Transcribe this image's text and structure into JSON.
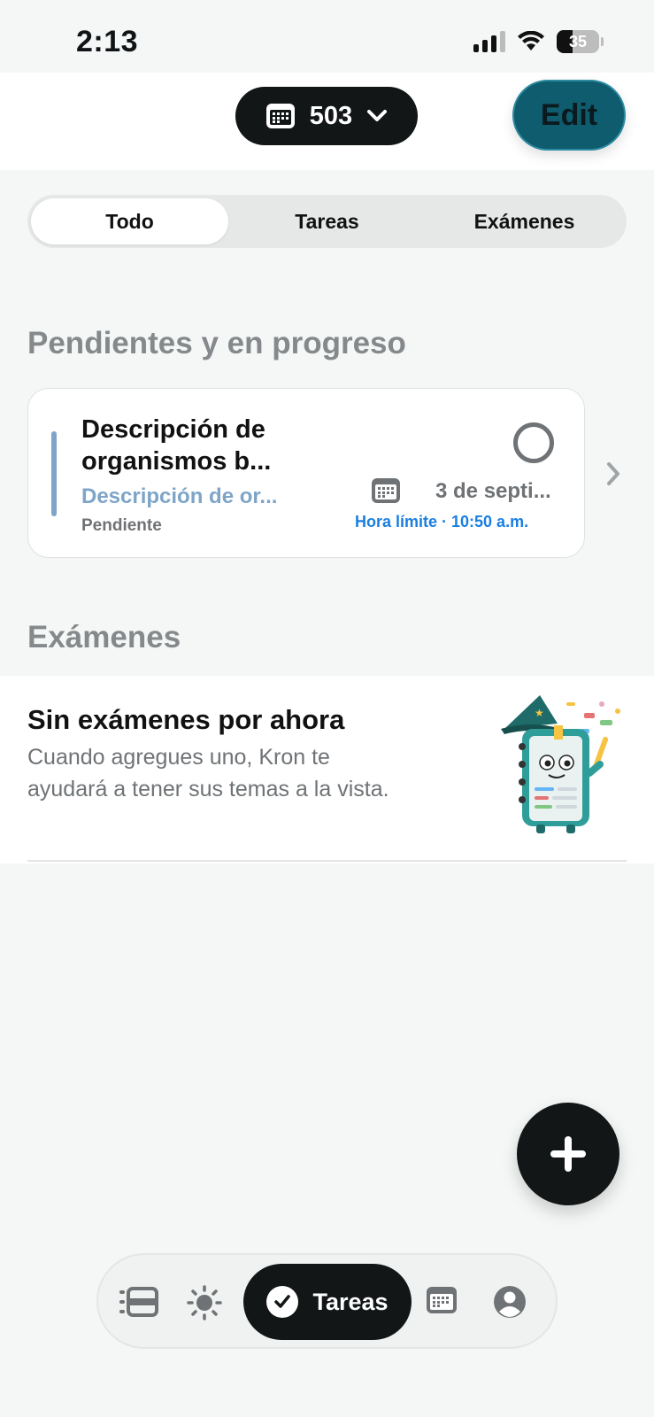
{
  "status_bar": {
    "time": "2:13",
    "battery": "35"
  },
  "header": {
    "group_label": "503",
    "edit_label": "Edit"
  },
  "tabs": [
    {
      "label": "Todo",
      "active": true
    },
    {
      "label": "Tareas",
      "active": false
    },
    {
      "label": "Exámenes",
      "active": false
    }
  ],
  "pending": {
    "section_title": "Pendientes y en progreso",
    "task": {
      "title": "Descripción de organismos b...",
      "subtitle": "Descripción de or...",
      "status": "Pendiente",
      "date": "3 de septi...",
      "deadline": "Hora límite · 10:50 a.m.",
      "accent_color": "#7ea5c8"
    }
  },
  "exams": {
    "section_title": "Exámenes",
    "empty_title": "Sin exámenes por ahora",
    "empty_desc": "Cuando agregues uno, Kron te ayudará a tener sus temas a la vista."
  },
  "bottom_nav": {
    "items": [
      {
        "icon": "list-icon"
      },
      {
        "icon": "sun-icon"
      },
      {
        "icon": "check-icon",
        "label": "Tareas",
        "active": true
      },
      {
        "icon": "calendar-icon"
      },
      {
        "icon": "profile-icon"
      }
    ]
  },
  "colors": {
    "dark": "#121617",
    "accent_blue": "#1a7fe0",
    "edit_teal": "#0e5c6e"
  }
}
